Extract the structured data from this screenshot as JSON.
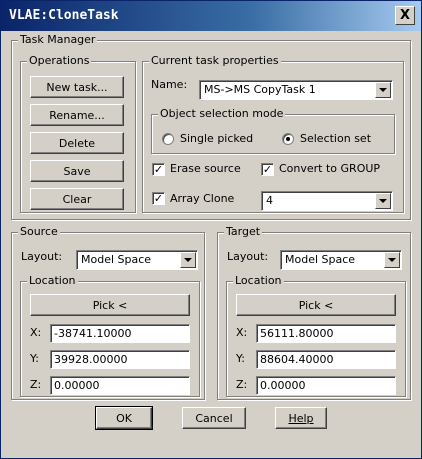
{
  "window": {
    "title": "VLAE:CloneTask",
    "close_glyph": "X"
  },
  "task_manager": {
    "label": "Task Manager",
    "operations": {
      "label": "Operations",
      "buttons": [
        "New task...",
        "Rename...",
        "Delete",
        "Save",
        "Clear"
      ]
    },
    "current": {
      "label": "Current task properties",
      "name_label": "Name:",
      "name_value": "MS->MS CopyTask 1",
      "object_selection": {
        "label": "Object selection mode",
        "options": [
          {
            "label": "Single picked",
            "selected": false
          },
          {
            "label": "Selection set",
            "selected": true
          }
        ]
      },
      "erase_source": {
        "label": "Erase source",
        "checked": true
      },
      "convert_group": {
        "label": "Convert to GROUP",
        "checked": true
      },
      "array_clone": {
        "label": "Array Clone",
        "checked": true
      },
      "array_count": "4"
    }
  },
  "source": {
    "label": "Source",
    "layout_label": "Layout:",
    "layout_value": "Model Space",
    "location": {
      "label": "Location",
      "pick_label": "Pick <",
      "x_label": "X:",
      "x": "-38741.10000",
      "y_label": "Y:",
      "y": "39928.00000",
      "z_label": "Z:",
      "z": "0.00000"
    }
  },
  "target": {
    "label": "Target",
    "layout_label": "Layout:",
    "layout_value": "Model Space",
    "location": {
      "label": "Location",
      "pick_label": "Pick <",
      "x_label": "X:",
      "x": "56111.80000",
      "y_label": "Y:",
      "y": "88604.40000",
      "z_label": "Z:",
      "z": "0.00000"
    }
  },
  "footer": {
    "ok": "OK",
    "cancel": "Cancel",
    "help": "Help"
  },
  "check_glyph": "✓",
  "colors": {
    "title_start": "#0a246a",
    "title_end": "#a6caf0",
    "face": "#d4d0c8"
  }
}
